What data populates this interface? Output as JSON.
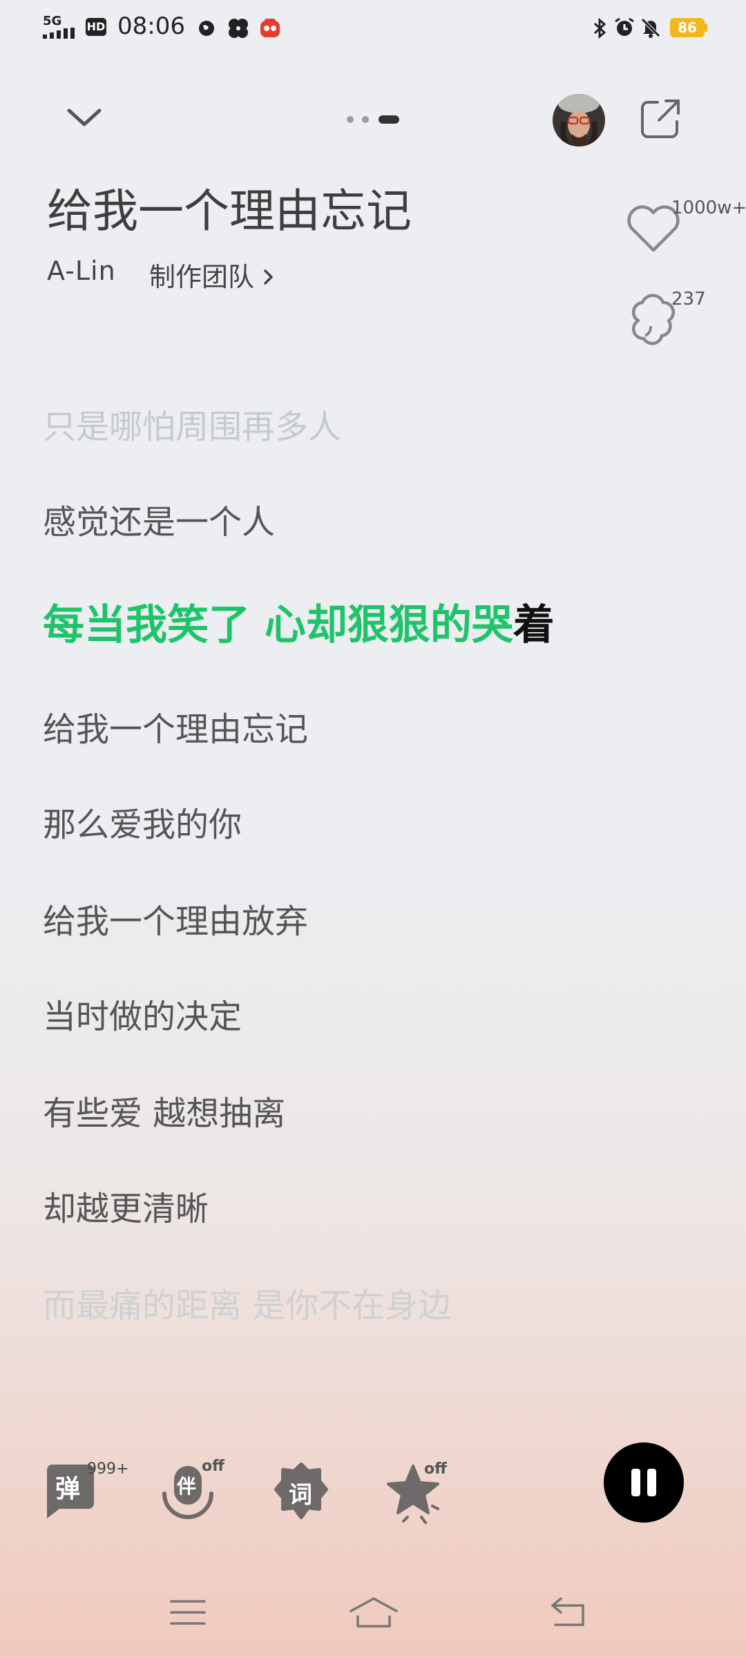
{
  "status_bar": {
    "network": "5G",
    "hd": "HD",
    "time": "08:06",
    "battery": "86"
  },
  "header": {
    "title": "给我一个理由忘记",
    "artist": "A-Lin",
    "team_link": "制作团队",
    "likes": "1000w+",
    "comments": "237"
  },
  "lyrics": {
    "prev_2": "只是哪怕周围再多人",
    "prev_1": "感觉还是一个人",
    "current_sung": "每当我笑了 心却狠狠的哭",
    "current_unsung": "着",
    "next_1": "给我一个理由忘记",
    "next_2": "那么爱我的你",
    "next_3": "给我一个理由放弃",
    "next_4": "当时做的决定",
    "next_5": "有些爱 越想抽离",
    "next_6": "却越更清晰",
    "next_7": "而最痛的距离 是你不在身边"
  },
  "controls": {
    "danmaku_label": "弹",
    "danmaku_count": "999+",
    "accompany_label": "伴",
    "accompany_state": "off",
    "lyrics_label": "词",
    "effect_state": "off"
  },
  "colors": {
    "accent": "#1fc46a",
    "battery": "#f3b719"
  }
}
